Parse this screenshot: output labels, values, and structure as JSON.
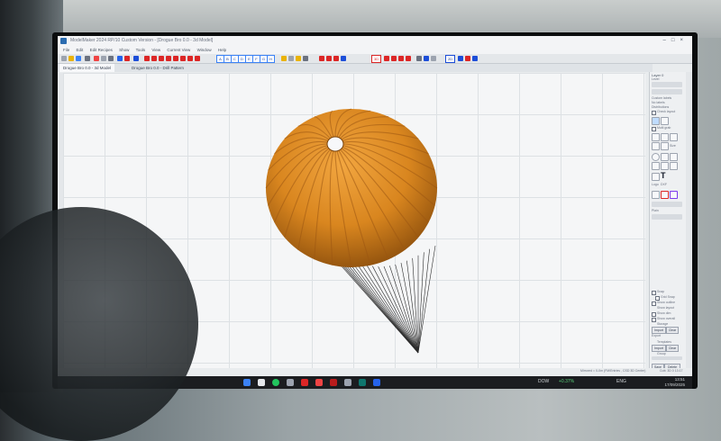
{
  "window": {
    "title": "ModelMaker 2024 RP/10 Custom Version - [Drogue Bro 0.0 - 3d Model]",
    "controls": [
      "–",
      "□",
      "×"
    ]
  },
  "menu": [
    "File",
    "Edit",
    "Edit Recipes",
    "Show",
    "Tools",
    "View",
    "Current View",
    "Window",
    "Help"
  ],
  "toolbar": {
    "letters": [
      "A",
      "B",
      "C",
      "D",
      "E",
      "F",
      "G",
      "H"
    ],
    "zoom": "3D",
    "mode": "2D"
  },
  "tabs": [
    {
      "label": "Drogue Bro 0.0 - 3d Model",
      "active": true
    },
    {
      "label": "Drogue Bro 0.0 - Drill Pattern",
      "active": false
    }
  ],
  "panel": {
    "header": "Layer 0",
    "level_label": "Level",
    "options": [
      "Custom labels",
      "No labels",
      "Distributions"
    ],
    "check_layout": "Check layout",
    "multi_grab": "Multi grab",
    "size_label": "Size",
    "text_label": "T",
    "logo_label": "Logo",
    "dxf_label": "DXF",
    "plain_label": "Plain",
    "snap": "Snap",
    "grid_snap": "Grid Snap",
    "show_outline": "Show outline",
    "show_layout": "Show layout",
    "show_dim": "Show dim",
    "show_overall": "Show overall",
    "storage": "Storage",
    "import_label": "Import",
    "clear_label": "Clear",
    "export_label": "Export",
    "template_label": "Templates",
    "import2": "Import",
    "clear2": "Clear",
    "group": "Group",
    "save": "Save",
    "delete": "Delete"
  },
  "status": {
    "left": "Mirrored = 0-0m (FM/Entries , CSD 3D Center)",
    "right": "Cutt: 3D 0 13:17"
  },
  "taskbar": {
    "dow": "DOW",
    "change": "+0.37%",
    "time": "13:51",
    "date": "17/09/2025",
    "lang": "ENG"
  },
  "model": {
    "canopy_color": "#c8781c",
    "gore_count": 28,
    "lines_color": "#2b2b2b"
  }
}
